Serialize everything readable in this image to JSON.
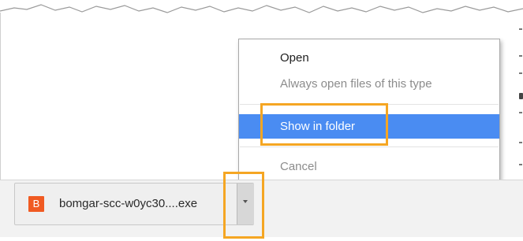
{
  "context_menu": {
    "items": [
      {
        "label": "Open",
        "state": "enabled"
      },
      {
        "label": "Always open files of this type",
        "state": "disabled"
      },
      {
        "label": "Show in folder",
        "state": "highlighted"
      },
      {
        "label": "Cancel",
        "state": "disabled"
      }
    ]
  },
  "download_shelf": {
    "item": {
      "icon_letter": "B",
      "icon_name": "bomgar-file-icon",
      "filename": "bomgar-scc-w0yc30....exe",
      "dropdown_icon": "chevron-down-icon"
    }
  },
  "colors": {
    "highlight_box": "#f5a623",
    "menu_active": "#4a8cf2",
    "file_icon": "#f05a22"
  }
}
